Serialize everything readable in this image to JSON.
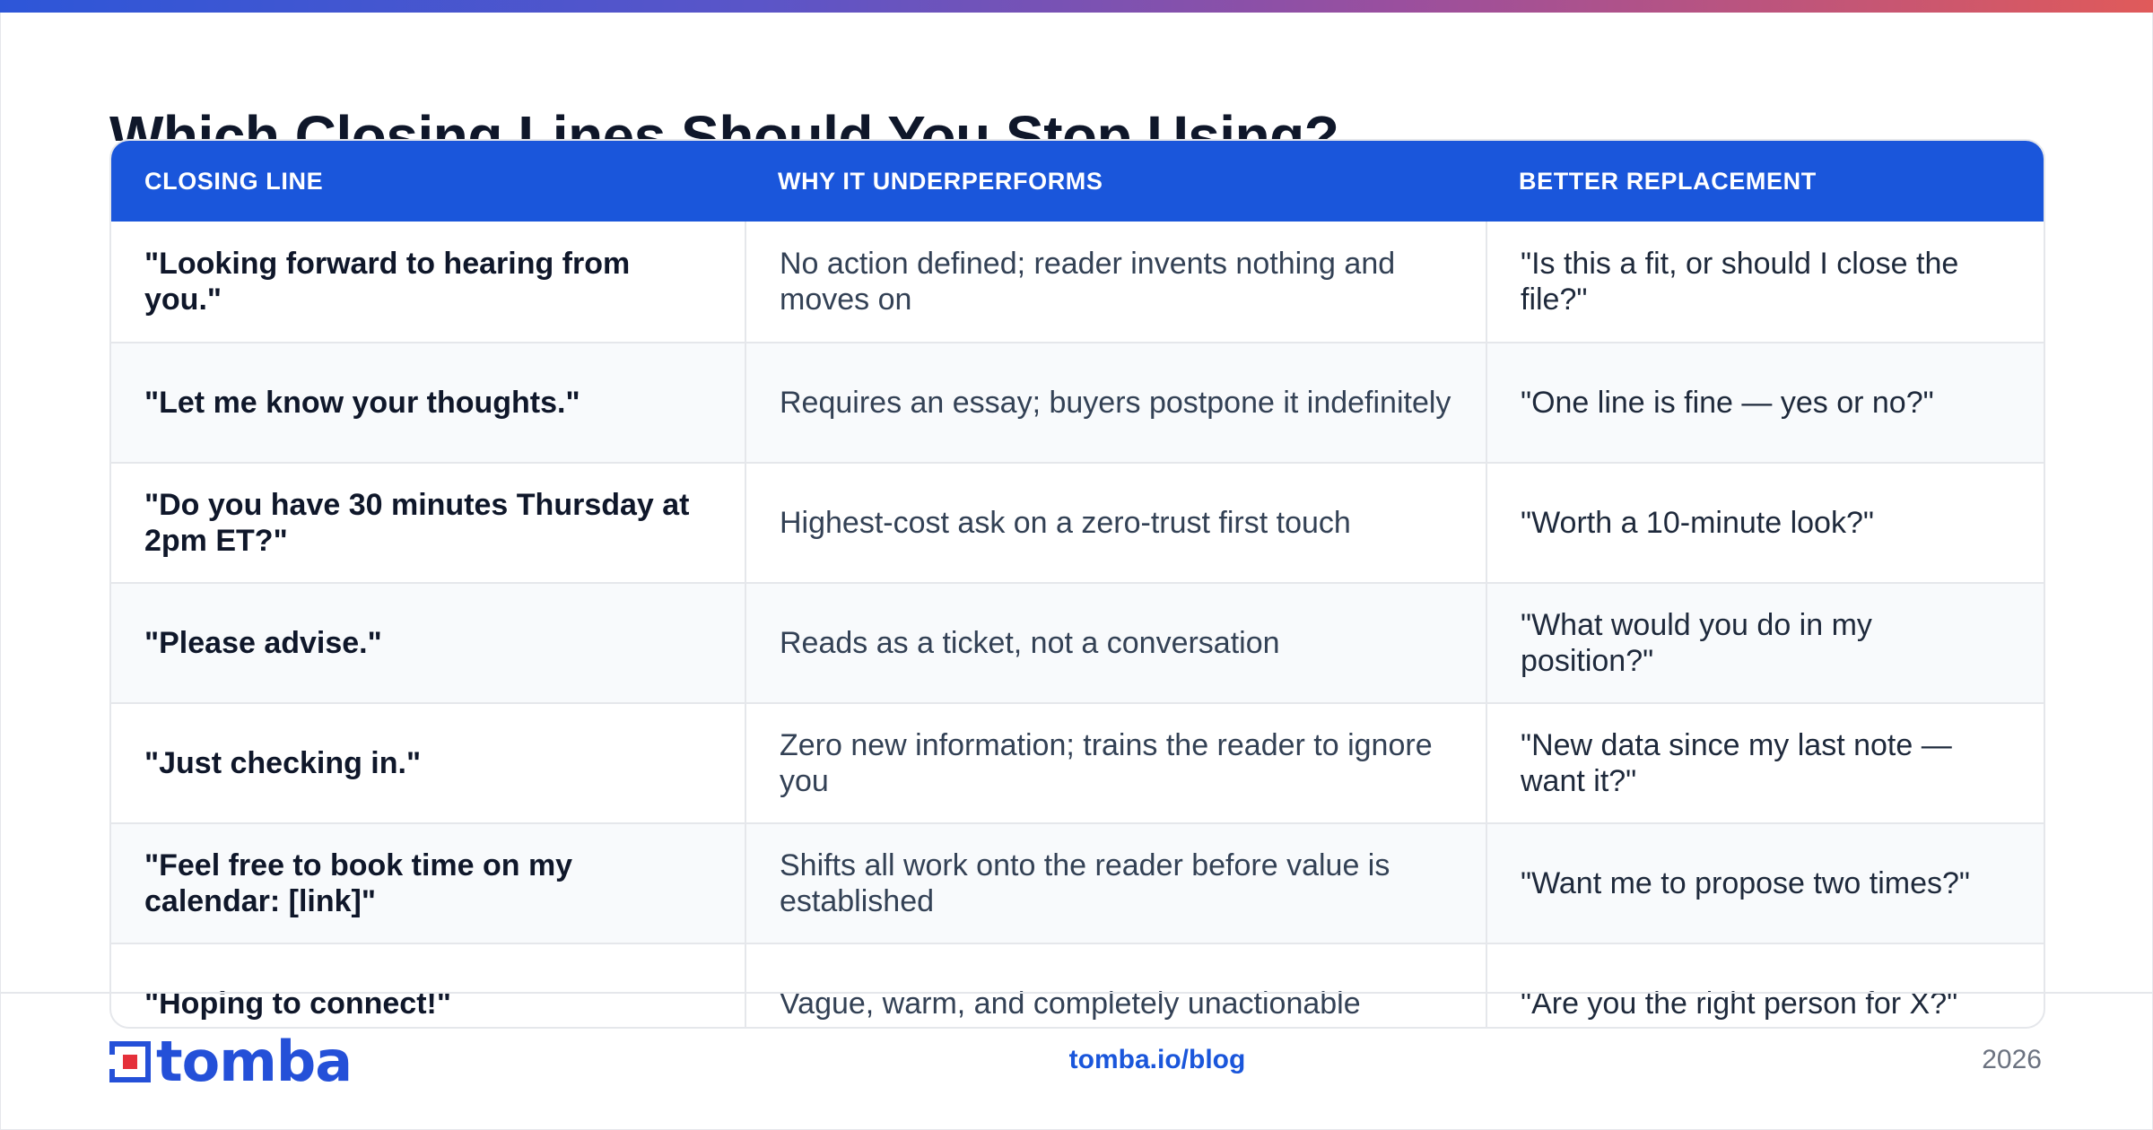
{
  "title": "Which Closing Lines Should You Stop Using?",
  "table": {
    "headers": [
      "CLOSING LINE",
      "WHY IT UNDERPERFORMS",
      "BETTER REPLACEMENT"
    ],
    "rows": [
      {
        "line": "\"Looking forward to hearing from you.\"",
        "why": "No action defined; reader invents nothing and moves on",
        "better": "\"Is this a fit, or should I close the file?\""
      },
      {
        "line": "\"Let me know your thoughts.\"",
        "why": "Requires an essay; buyers postpone it indefinitely",
        "better": "\"One line is fine — yes or no?\""
      },
      {
        "line": "\"Do you have 30 minutes Thursday at 2pm ET?\"",
        "why": "Highest-cost ask on a zero-trust first touch",
        "better": "\"Worth a 10-minute look?\""
      },
      {
        "line": "\"Please advise.\"",
        "why": "Reads as a ticket, not a conversation",
        "better": "\"What would you do in my position?\""
      },
      {
        "line": "\"Just checking in.\"",
        "why": "Zero new information; trains the reader to ignore you",
        "better": "\"New data since my last note — want it?\""
      },
      {
        "line": "\"Feel free to book time on my calendar: [link]\"",
        "why": "Shifts all work onto the reader before value is established",
        "better": "\"Want me to propose two times?\""
      },
      {
        "line": "\"Hoping to connect!\"",
        "why": "Vague, warm, and completely unactionable",
        "better": "\"Are you the right person for X?\""
      }
    ]
  },
  "footer": {
    "logo_text": "tomba",
    "site": "tomba.io/blog",
    "year": "2026"
  },
  "colors": {
    "header_bg": "#1a56db",
    "accent": "#1a56db",
    "row_alt": "#f8fafc"
  }
}
